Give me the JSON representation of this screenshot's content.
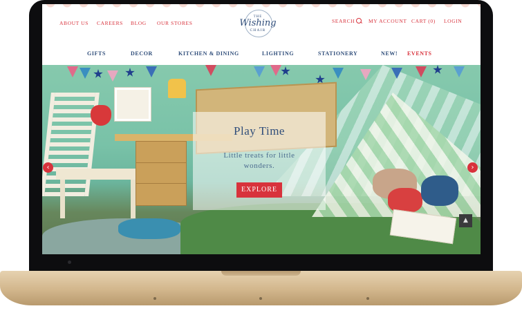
{
  "header": {
    "left_links": [
      "ABOUT US",
      "CAREERS",
      "BLOG",
      "OUR STORES"
    ],
    "right_links": {
      "search": "SEARCH",
      "account": "MY ACCOUNT",
      "cart": "CART (0)",
      "login": "LOGIN"
    },
    "logo": {
      "the": "THE",
      "name": "Wishing",
      "chair": "CHAIR"
    }
  },
  "nav": [
    "GIFTS",
    "DECOR",
    "KITCHEN & DINING",
    "LIGHTING",
    "STATIONERY",
    "NEW!",
    "EVENTS"
  ],
  "hero": {
    "title": "Play Time",
    "subtitle": "Little treats for little wonders.",
    "cta": "EXPLORE",
    "prev_arrow": "‹",
    "next_arrow": "›",
    "to_top": "▲"
  },
  "colors": {
    "accent": "#d8323c",
    "navy": "#2f4d7a",
    "laptop_gold": "#d2b68c"
  },
  "icons": {
    "search": "search-icon",
    "prev": "chevron-left-icon",
    "next": "chevron-right-icon",
    "top": "chevron-up-icon"
  }
}
